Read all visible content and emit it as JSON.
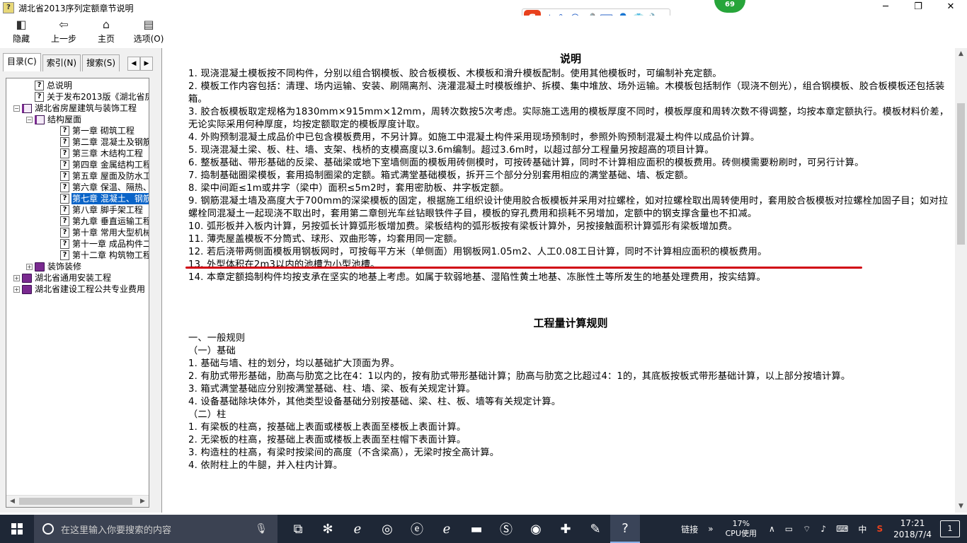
{
  "window": {
    "title": "湖北省2013序列定额章节说明",
    "app_icon": "chm-help-icon",
    "controls": [
      "─",
      "❐",
      "✕"
    ],
    "badge": "69"
  },
  "ime": {
    "brand": "S",
    "items": [
      "中",
      "°,",
      "☺",
      "🎤",
      "⌨",
      "👤",
      "👕",
      "🔧"
    ]
  },
  "toolbar": {
    "buttons": [
      {
        "label": "隐藏",
        "icon": "hide-icon",
        "glyph": "◧"
      },
      {
        "label": "上一步",
        "icon": "back-arrow-icon",
        "glyph": "⇦"
      },
      {
        "label": "主页",
        "icon": "home-icon",
        "glyph": "⌂"
      },
      {
        "label": "选项(O)",
        "icon": "options-icon",
        "glyph": "▤"
      }
    ]
  },
  "tabs": {
    "items": [
      "目录(C)",
      "索引(N)",
      "搜索(S)"
    ],
    "active": 0,
    "prev": "◀",
    "next": "▶"
  },
  "tree": [
    {
      "level": 1,
      "icon": "page",
      "label": "总说明",
      "exp": ""
    },
    {
      "level": 1,
      "icon": "page",
      "label": "关于发布2013版《湖北省房屋",
      "exp": ""
    },
    {
      "level": 0,
      "icon": "open",
      "label": "湖北省房屋建筑与装饰工程",
      "exp": "−"
    },
    {
      "level": 1,
      "icon": "open",
      "label": "结构屋面",
      "exp": "−"
    },
    {
      "level": 2,
      "icon": "page",
      "label": "第一章 砌筑工程",
      "exp": ""
    },
    {
      "level": 2,
      "icon": "page",
      "label": "第二章 混凝土及钢筋",
      "exp": ""
    },
    {
      "level": 2,
      "icon": "page",
      "label": "第三章 木结构工程",
      "exp": ""
    },
    {
      "level": 2,
      "icon": "page",
      "label": "第四章 金属结构工程",
      "exp": ""
    },
    {
      "level": 2,
      "icon": "page",
      "label": "第五章 屋面及防水工",
      "exp": ""
    },
    {
      "level": 2,
      "icon": "page",
      "label": "第六章 保温、隔热、",
      "exp": ""
    },
    {
      "level": 2,
      "icon": "page",
      "label": "第七章 混凝土、钢筋",
      "exp": "",
      "selected": true
    },
    {
      "level": 2,
      "icon": "page",
      "label": "第八章 脚手架工程",
      "exp": ""
    },
    {
      "level": 2,
      "icon": "page",
      "label": "第九章 垂直运输工程",
      "exp": ""
    },
    {
      "level": 2,
      "icon": "page",
      "label": "第十章 常用大型机械",
      "exp": ""
    },
    {
      "level": 2,
      "icon": "page",
      "label": "第十一章 成品构件二",
      "exp": ""
    },
    {
      "level": 2,
      "icon": "page",
      "label": "第十二章 构筑物工程",
      "exp": ""
    },
    {
      "level": 1,
      "icon": "book",
      "label": "装饰装修",
      "exp": "+"
    },
    {
      "level": 0,
      "icon": "book",
      "label": "湖北省通用安装工程",
      "exp": "+"
    },
    {
      "level": 0,
      "icon": "book",
      "label": "湖北省建设工程公共专业费用",
      "exp": "+"
    }
  ],
  "content": {
    "title": "说明",
    "paragraphs": [
      "1. 现浇混凝土模板按不同构件，分别以组合钢模板、胶合板模板、木模板和滑升模板配制。使用其他模板时，可编制补充定额。",
      "2. 模板工作内容包括：清理、场内运输、安装、刷隔离剂、浇灌混凝土时模板维护、拆模、集中堆放、场外运输。木模板包括制作（现浇不刨光），组合钢模板、胶合板模板还包括装箱。",
      "3. 胶合板模板取定规格为1830mm×915mm×12mm，周转次数按5次考虑。实际施工选用的模板厚度不同时，模板厚度和周转次数不得调整，均按本章定额执行。模板材料价差，无论实际采用何种厚度，均按定额取定的模板厚度计取。",
      "4. 外购预制混凝土成品价中已包含模板费用，不另计算。如施工中混凝土构件采用现场预制时，参照外购预制混凝土构件以成品价计算。",
      "5. 现浇混凝土梁、板、柱、墙、支架、栈桥的支模高度以3.6m编制。超过3.6m时，以超过部分工程量另按超高的项目计算。",
      "6. 整板基础、带形基础的反梁、基础梁或地下室墙侧面的模板用砖侧模时，可按砖基础计算，同时不计算相应面积的模板费用。砖侧模需要粉刷时，可另行计算。",
      "7. 捣制基础圈梁模板，套用捣制圈梁的定额。箱式满堂基础模板，拆开三个部分分别套用相应的满堂基础、墙、板定额。",
      "8. 梁中间距≤1m或井字（梁中）面积≤5m2时，套用密肋板、井字板定额。",
      "9. 钢筋混凝土墙及高度大于700mm的深梁模板的固定，根据施工组织设计使用胶合板模板并采用对拉螺栓，如对拉螺栓取出周转使用时，套用胶合板模板对拉螺栓加固子目；如对拉螺栓同混凝土一起现浇不取出时，套用第二章刨光车丝钻眼铁件子目，模板的穿孔费用和损耗不另增加，定额中的钢支撑含量也不扣减。",
      "10. 弧形板并入板内计算，另按弧长计算弧形板增加费。梁板结构的弧形板按有梁板计算外，另按接触面积计算弧形有梁板增加费。",
      "11. 薄壳屋盖模板不分筒式、球形、双曲形等，均套用同一定额。",
      "12. 若后浇带两侧面模板用钢板网时，可按每平方米（单侧面）用钢板网1.05m2、人工0.08工日计算，同时不计算相应面积的模板费用。",
      "13. 外型体积在2m3以内的池槽为小型池槽。",
      "14. 本章定额捣制构件均按支承在坚实的地基上考虑。如属于软弱地基、湿陷性黄土地基、冻胀性土等所发生的地基处理费用，按实结算。"
    ],
    "subtitle": "工程量计算规则",
    "rules": [
      "一、一般规则",
      "（一）基础",
      "1. 基础与墙、柱的划分，均以基础扩大顶面为界。",
      "2. 有肋式带形基础，肋高与肋宽之比在4：1以内的，按有肋式带形基础计算；肋高与肋宽之比超过4：1的，其底板按板式带形基础计算，以上部分按墙计算。",
      "3. 箱式满堂基础应分别按满堂基础、柱、墙、梁、板有关规定计算。",
      "4. 设备基础除块体外，其他类型设备基础分别按基础、梁、柱、板、墙等有关规定计算。",
      "（二）柱",
      "1. 有梁板的柱高，按基础上表面或楼板上表面至楼板上表面计算。",
      "2. 无梁板的柱高，按基础上表面或楼板上表面至柱帽下表面计算。",
      "3. 构造柱的柱高，有梁时按梁间的高度（不含梁高），无梁时按全高计算。",
      "4. 依附柱上的牛腿，并入柱内计算。"
    ]
  },
  "taskbar": {
    "search_placeholder": "在这里输入你要搜索的内容",
    "apps": [
      {
        "name": "task-view-icon",
        "glyph": "⧉"
      },
      {
        "name": "fan-app-icon",
        "glyph": "✻"
      },
      {
        "name": "ie-icon",
        "glyph": "ℯ"
      },
      {
        "name": "chrome-like-icon",
        "glyph": "◎"
      },
      {
        "name": "edge-icon",
        "glyph": "ⓔ"
      },
      {
        "name": "ie-blue-icon",
        "glyph": "ℯ"
      },
      {
        "name": "folder-icon",
        "glyph": "▬"
      },
      {
        "name": "sogou-browser-icon",
        "glyph": "Ⓢ"
      },
      {
        "name": "green-app-icon",
        "glyph": "◉"
      },
      {
        "name": "plus-app-icon",
        "glyph": "✚"
      },
      {
        "name": "notes-icon",
        "glyph": "✎"
      },
      {
        "name": "help-app-icon",
        "glyph": "?"
      }
    ],
    "link_label": "链接",
    "cpu_percent": "17%",
    "cpu_label": "CPU使用",
    "ime_lang": "中",
    "time": "17:21",
    "date": "2018/7/4",
    "notifications": "1"
  }
}
